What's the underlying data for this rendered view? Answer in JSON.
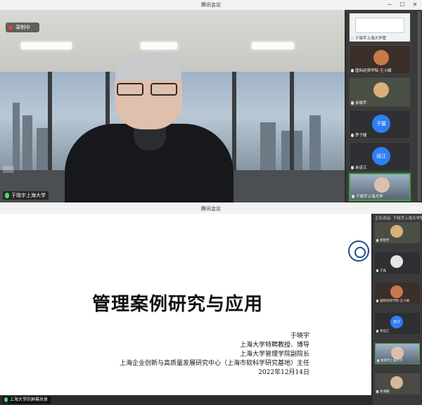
{
  "top_window": {
    "title": "腾讯会议",
    "recording_label": "录制中",
    "speaker_name": "于晓宇上海大学",
    "participants": [
      {
        "name": "于晓宇上海大学管",
        "kind": "screen"
      },
      {
        "name": "国际经贸学院-王小娟",
        "kind": "photo"
      },
      {
        "name": "余晓宇",
        "kind": "photo"
      },
      {
        "name": "罗子媛",
        "kind": "bubble",
        "initials": "子媛",
        "color": "#2f7ef5"
      },
      {
        "name": "余运江",
        "kind": "bubble",
        "initials": "运江",
        "color": "#2f7ef5"
      },
      {
        "name": "于晓宇上海大学",
        "kind": "video"
      }
    ]
  },
  "bottom_window": {
    "title": "腾讯会议",
    "panel_header": "正在讲话: 于晓宇上海大学管",
    "slide": {
      "title": "管理案例研究与应用",
      "lines": [
        "于晓宇",
        "上海大学特聘教授、博导",
        "上海大学管理学院副院长",
        "上海企业创新与高质量发展研究中心（上海市软科学研究基地）主任",
        "2022年12月14日"
      ]
    },
    "share_label": "上海大学的屏幕共享",
    "participants": [
      {
        "name": "余晓宇",
        "kind": "photo"
      },
      {
        "name": "于晶",
        "kind": "avatar"
      },
      {
        "name": "国际经贸学院-王小娟",
        "kind": "photo"
      },
      {
        "name": "余运江",
        "kind": "bubble",
        "initials": "运江",
        "color": "#2f7ef5"
      },
      {
        "name": "余晓宇上海大学",
        "kind": "video"
      },
      {
        "name": "余海鹏",
        "kind": "photo"
      }
    ]
  }
}
